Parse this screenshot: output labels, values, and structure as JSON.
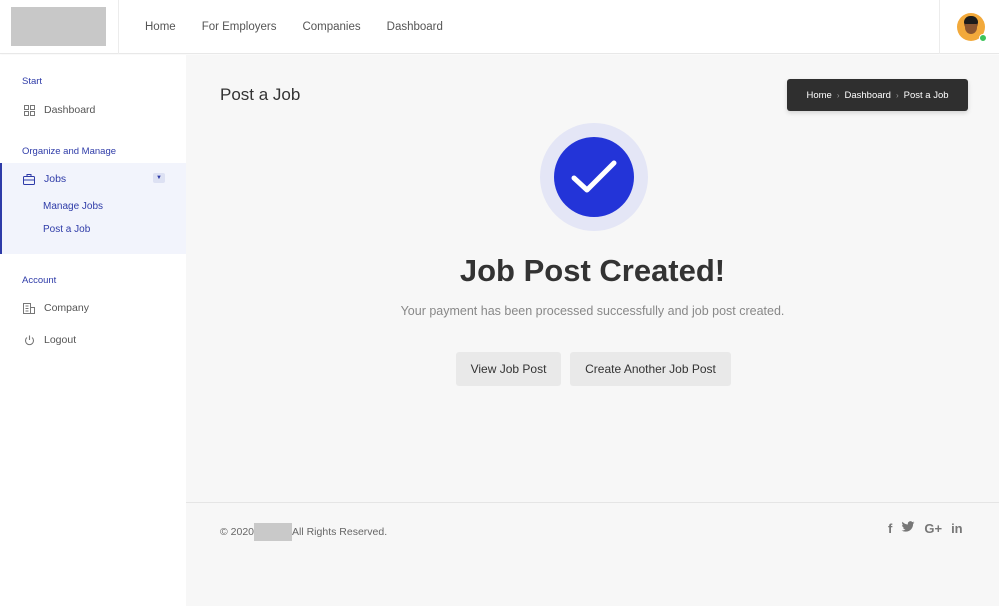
{
  "header": {
    "nav": [
      "Home",
      "For Employers",
      "Companies",
      "Dashboard"
    ]
  },
  "sidebar": {
    "sections": [
      {
        "heading": "Start"
      },
      {
        "heading": "Organize and Manage"
      },
      {
        "heading": "Account"
      }
    ],
    "items": {
      "dashboard": "Dashboard",
      "jobs": "Jobs",
      "manage_jobs": "Manage Jobs",
      "post_job": "Post a Job",
      "company": "Company",
      "logout": "Logout"
    }
  },
  "main": {
    "page_title": "Post a Job",
    "breadcrumb": [
      "Home",
      "Dashboard",
      "Post a Job"
    ],
    "success_title": "Job Post Created!",
    "success_message": "Your payment has been processed successfully and job post created.",
    "buttons": {
      "view": "View Job Post",
      "create": "Create Another Job Post"
    }
  },
  "footer": {
    "copyright_prefix": "© 2020",
    "copyright_suffix": "All Rights Reserved.",
    "socials": [
      "facebook-icon",
      "twitter-icon",
      "google-plus-icon",
      "linkedin-icon"
    ]
  },
  "colors": {
    "accent": "#2e3ba8",
    "check": "#2334d8"
  }
}
